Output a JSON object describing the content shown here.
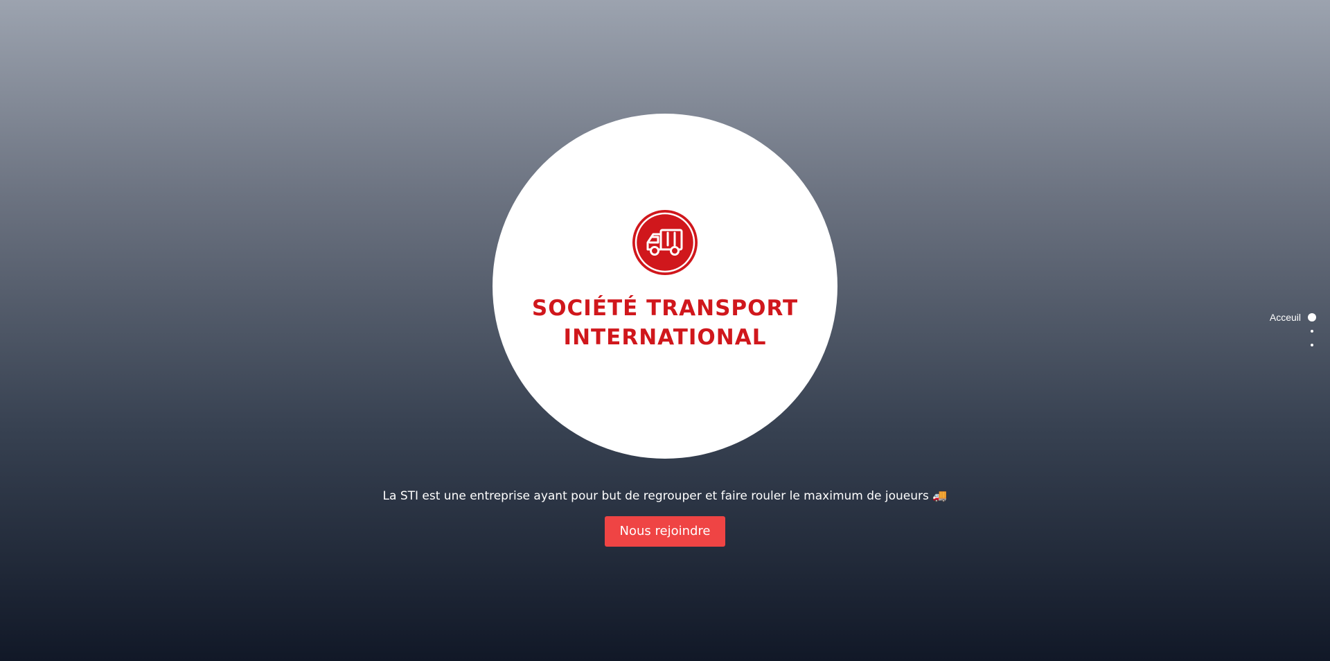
{
  "logo": {
    "line1": "SOCIÉTÉ TRANSPORT",
    "line2": "INTERNATIONAL",
    "brand_color": "#d0171c",
    "badge_icon": "truck-icon"
  },
  "tagline": "La STI est une entreprise ayant pour but de regrouper et faire rouler le maximum de joueurs 🚚",
  "cta": {
    "label": "Nous rejoindre",
    "color": "#ef4444"
  },
  "side_nav": {
    "items": [
      {
        "label": "Acceuil",
        "active": true
      },
      {
        "label": "",
        "active": false
      },
      {
        "label": "",
        "active": false
      }
    ]
  }
}
